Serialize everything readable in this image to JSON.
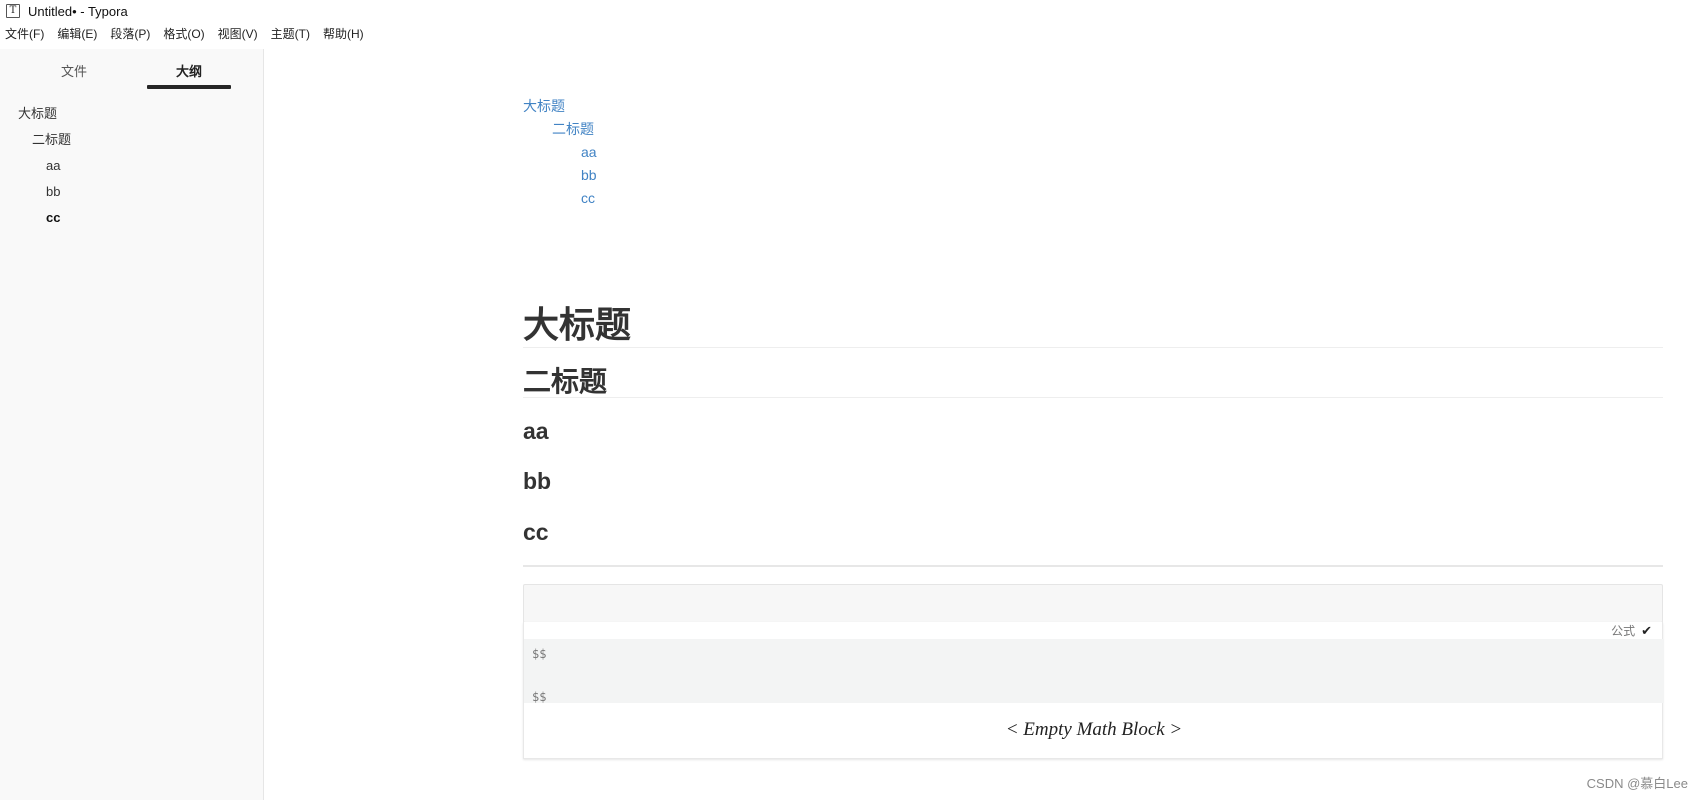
{
  "window": {
    "app_icon_glyph": "T",
    "title": "Untitled• - Typora"
  },
  "menubar": {
    "items": [
      "文件(F)",
      "编辑(E)",
      "段落(P)",
      "格式(O)",
      "视图(V)",
      "主题(T)",
      "帮助(H)"
    ]
  },
  "sidebar": {
    "tabs": [
      {
        "label": "文件",
        "active": false
      },
      {
        "label": "大纲",
        "active": true
      }
    ],
    "outline": [
      {
        "label": "大标题",
        "level": 1
      },
      {
        "label": "二标题",
        "level": 2
      },
      {
        "label": "aa",
        "level": 3
      },
      {
        "label": "bb",
        "level": 3
      },
      {
        "label": "cc",
        "level": 3,
        "active": true
      }
    ]
  },
  "document": {
    "toc": [
      {
        "label": "大标题",
        "level": 1
      },
      {
        "label": "二标题",
        "level": 2
      },
      {
        "label": "aa",
        "level": 3
      },
      {
        "label": "bb",
        "level": 3
      },
      {
        "label": "cc",
        "level": 3
      }
    ],
    "h1": "大标题",
    "h2": "二标题",
    "h3": [
      "aa",
      "bb",
      "cc"
    ],
    "math_block": {
      "lang_label": "公式",
      "lang_confirm_icon": "checkmark-icon",
      "source_open": "$$",
      "source_close": "$$",
      "preview": "< Empty Math Block >"
    }
  },
  "watermark": "CSDN @慕白Lee",
  "colors": {
    "link": "#4183c4",
    "sidebar_bg": "#f9f9f9",
    "tab_indicator": "#262626",
    "math_source_bg": "#f3f4f4"
  }
}
